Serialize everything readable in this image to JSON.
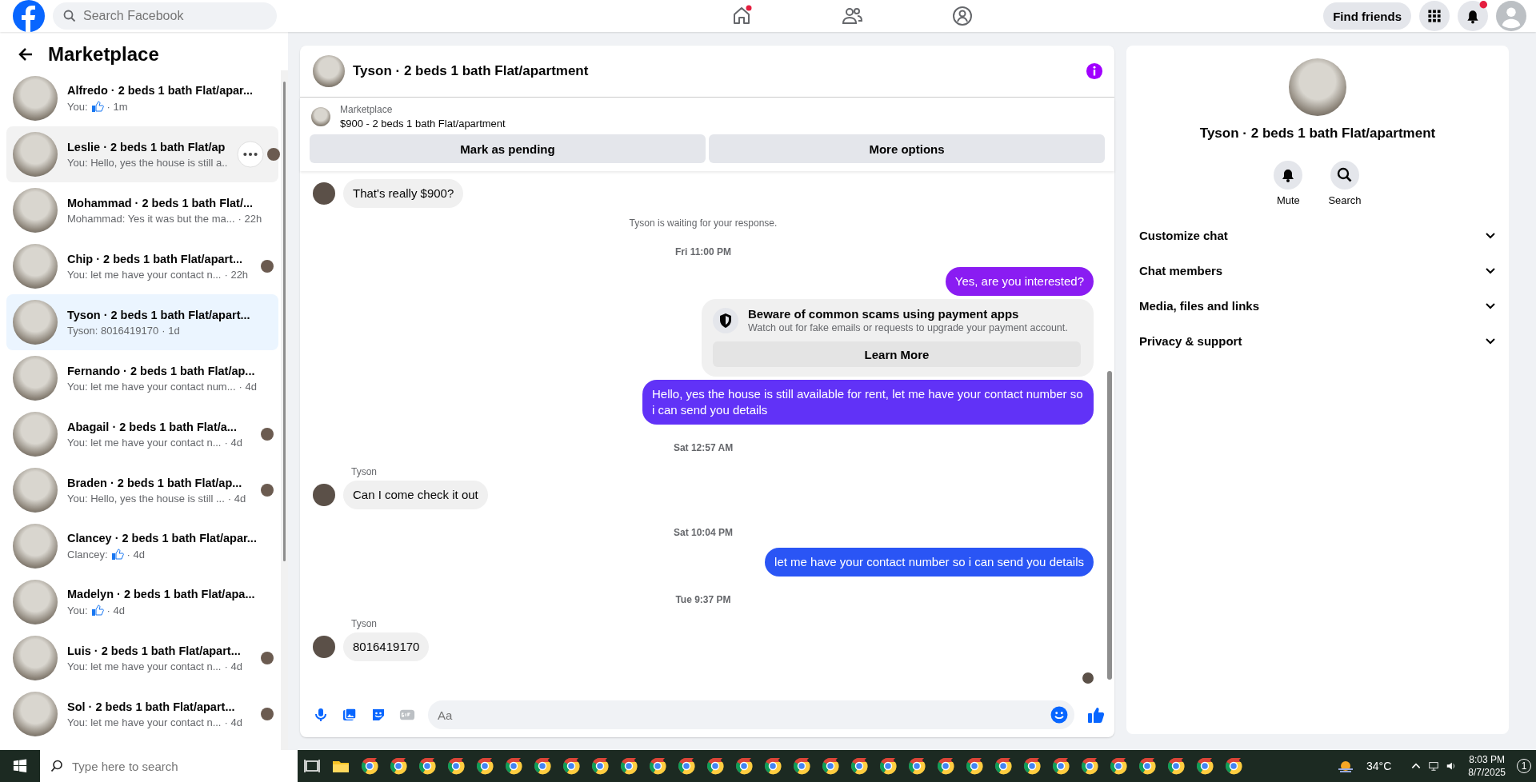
{
  "topbar": {
    "search_placeholder": "Search Facebook",
    "find_friends": "Find friends"
  },
  "sidebar": {
    "title": "Marketplace",
    "conversations": [
      {
        "title": "Alfredo · 2 beds 1 bath Flat/apar...",
        "preview": "You:",
        "like": true,
        "time": "· 1m",
        "seen": false,
        "selected": false,
        "hovered": false
      },
      {
        "title": "Leslie · 2 beds 1 bath Flat/ap",
        "preview": "You: Hello, yes the house is still a..",
        "like": false,
        "seen": true,
        "selected": false,
        "hovered": true
      },
      {
        "title": "Mohammad · 2 beds 1 bath Flat/...",
        "preview": "Mohammad: Yes it was but the ma...",
        "like": false,
        "time": "· 22h",
        "seen": false,
        "selected": false,
        "hovered": false
      },
      {
        "title": "Chip · 2 beds 1 bath Flat/apart...",
        "preview": "You: let me have your contact n...",
        "like": false,
        "time": "· 22h",
        "seen": true,
        "selected": false,
        "hovered": false
      },
      {
        "title": "Tyson · 2 beds 1 bath Flat/apart...",
        "preview": "Tyson: 8016419170",
        "like": false,
        "time": "· 1d",
        "seen": false,
        "selected": true,
        "hovered": false
      },
      {
        "title": "Fernando · 2 beds 1 bath Flat/ap...",
        "preview": "You: let me have your contact num...",
        "like": false,
        "time": "· 4d",
        "seen": false,
        "selected": false,
        "hovered": false
      },
      {
        "title": "Abagail · 2 beds 1 bath Flat/a...",
        "preview": "You: let me have your contact n...",
        "like": false,
        "time": "· 4d",
        "seen": true,
        "selected": false,
        "hovered": false
      },
      {
        "title": "Braden · 2 beds 1 bath Flat/ap...",
        "preview": "You: Hello, yes the house is still ...",
        "like": false,
        "time": "· 4d",
        "seen": true,
        "selected": false,
        "hovered": false
      },
      {
        "title": "Clancey · 2 beds 1 bath Flat/apar...",
        "preview": "Clancey:",
        "like": true,
        "time": "· 4d",
        "seen": false,
        "selected": false,
        "hovered": false
      },
      {
        "title": "Madelyn · 2 beds 1 bath Flat/apa...",
        "preview": "You:",
        "like": true,
        "time": "· 4d",
        "seen": false,
        "selected": false,
        "hovered": false
      },
      {
        "title": "Luis · 2 beds 1 bath Flat/apart...",
        "preview": "You: let me have your contact n...",
        "like": false,
        "time": "· 4d",
        "seen": true,
        "selected": false,
        "hovered": false
      },
      {
        "title": "Sol · 2 beds 1 bath Flat/apart...",
        "preview": "You: let me have your contact n...",
        "like": false,
        "time": "· 4d",
        "seen": true,
        "selected": false,
        "hovered": false
      }
    ]
  },
  "chat": {
    "title": "Tyson · 2 beds 1 bath Flat/apartment",
    "listing": {
      "label": "Marketplace",
      "item": "$900 - 2 beds 1 bath Flat/apartment",
      "buttons": [
        "Mark as pending",
        "More options"
      ]
    },
    "messages": [
      {
        "kind": "incoming",
        "text": "That's really $900?"
      },
      {
        "kind": "notice",
        "text": "Tyson is waiting for your response."
      },
      {
        "kind": "timestamp",
        "text": "Fri 11:00 PM"
      },
      {
        "kind": "outgoing",
        "text": "Yes, are you interested?",
        "color": "#8a1cf2"
      },
      {
        "kind": "warning",
        "title": "Beware of common scams using payment apps",
        "text": "Watch out for fake emails or requests to upgrade your payment account.",
        "button": "Learn More"
      },
      {
        "kind": "outgoing",
        "text": "Hello, yes the house is still available for rent, let me have your contact number so i can send you details",
        "color": "#6132f7"
      },
      {
        "kind": "timestamp",
        "text": "Sat 12:57 AM"
      },
      {
        "kind": "incoming",
        "text": "Can I come check it out",
        "sender": "Tyson"
      },
      {
        "kind": "timestamp",
        "text": "Sat 10:04 PM"
      },
      {
        "kind": "outgoing",
        "text": "let me have your contact number so i can send you details",
        "color": "#2a55f5"
      },
      {
        "kind": "timestamp",
        "text": "Tue 9:37 PM"
      },
      {
        "kind": "incoming",
        "text": "8016419170",
        "sender": "Tyson"
      }
    ],
    "composer": {
      "placeholder": "Aa"
    }
  },
  "details": {
    "title": "Tyson · 2 beds 1 bath Flat/apartment",
    "actions": [
      {
        "kind": "mute",
        "label": "Mute"
      },
      {
        "kind": "search",
        "label": "Search"
      }
    ],
    "sections": [
      {
        "label": "Customize chat",
        "expanded": false
      },
      {
        "label": "Chat members",
        "expanded": false
      },
      {
        "label": "Media, files and links",
        "expanded": false
      },
      {
        "label": "Privacy & support",
        "expanded": false
      }
    ]
  },
  "taskbar": {
    "search_placeholder": "Type here to search",
    "weather": "34°C",
    "time": "8:03 PM",
    "date": "8/7/2025",
    "notifications": "1"
  }
}
